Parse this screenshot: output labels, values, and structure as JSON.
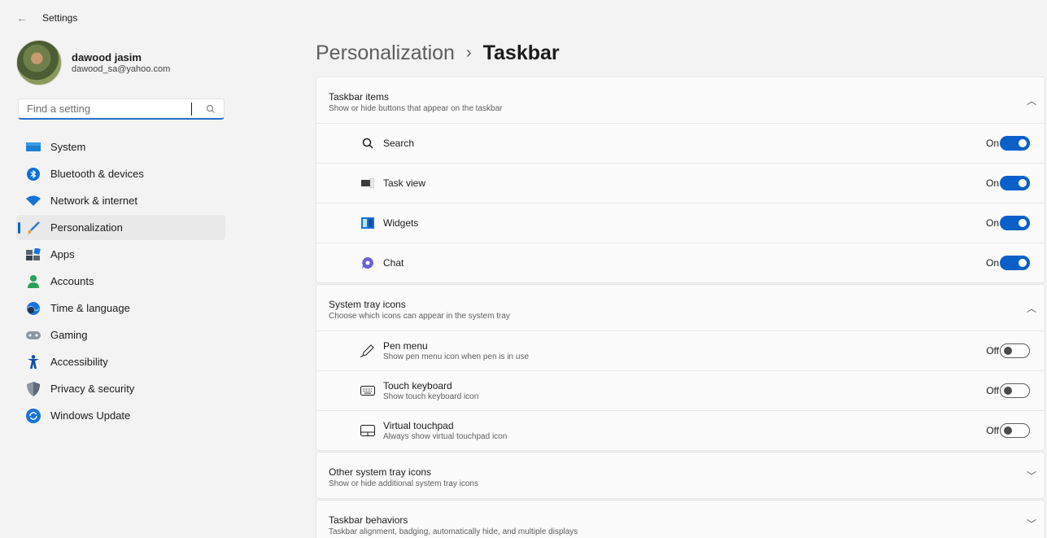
{
  "window": {
    "title": "Settings",
    "back_icon": "back-arrow-icon"
  },
  "profile": {
    "name": "dawood jasim",
    "email": "dawood_sa@yahoo.com"
  },
  "search": {
    "placeholder": "Find a setting",
    "icon": "search-icon"
  },
  "nav": {
    "items": [
      {
        "label": "System",
        "icon": "system-icon",
        "selected": false
      },
      {
        "label": "Bluetooth & devices",
        "icon": "bluetooth-icon",
        "selected": false
      },
      {
        "label": "Network & internet",
        "icon": "network-icon",
        "selected": false
      },
      {
        "label": "Personalization",
        "icon": "brush-icon",
        "selected": true
      },
      {
        "label": "Apps",
        "icon": "apps-icon",
        "selected": false
      },
      {
        "label": "Accounts",
        "icon": "accounts-icon",
        "selected": false
      },
      {
        "label": "Time & language",
        "icon": "globe-clock-icon",
        "selected": false
      },
      {
        "label": "Gaming",
        "icon": "gamepad-icon",
        "selected": false
      },
      {
        "label": "Accessibility",
        "icon": "accessibility-icon",
        "selected": false
      },
      {
        "label": "Privacy & security",
        "icon": "shield-icon",
        "selected": false
      },
      {
        "label": "Windows Update",
        "icon": "update-icon",
        "selected": false
      }
    ]
  },
  "breadcrumb": {
    "parent": "Personalization",
    "separator": "›",
    "current": "Taskbar"
  },
  "sections": {
    "taskbar_items": {
      "title": "Taskbar items",
      "subtitle": "Show or hide buttons that appear on the taskbar",
      "expanded": true,
      "rows": [
        {
          "label": "Search",
          "icon": "search-icon",
          "state": "On"
        },
        {
          "label": "Task view",
          "icon": "task-view-icon",
          "state": "On"
        },
        {
          "label": "Widgets",
          "icon": "widgets-icon",
          "state": "On"
        },
        {
          "label": "Chat",
          "icon": "chat-icon",
          "state": "On"
        }
      ]
    },
    "system_tray": {
      "title": "System tray icons",
      "subtitle": "Choose which icons can appear in the system tray",
      "expanded": true,
      "rows": [
        {
          "label": "Pen menu",
          "sub": "Show pen menu icon when pen is in use",
          "icon": "pen-icon",
          "state": "Off"
        },
        {
          "label": "Touch keyboard",
          "sub": "Show touch keyboard icon",
          "icon": "keyboard-icon",
          "state": "Off"
        },
        {
          "label": "Virtual touchpad",
          "sub": "Always show virtual touchpad icon",
          "icon": "touchpad-icon",
          "state": "Off"
        }
      ]
    },
    "other_tray": {
      "title": "Other system tray icons",
      "subtitle": "Show or hide additional system tray icons",
      "expanded": false
    },
    "behaviors": {
      "title": "Taskbar behaviors",
      "subtitle": "Taskbar alignment, badging, automatically hide, and multiple displays",
      "expanded": false
    }
  },
  "colors": {
    "accent": "#0a5fc8",
    "background": "#f3f3f3",
    "card": "#fbfbfb"
  }
}
